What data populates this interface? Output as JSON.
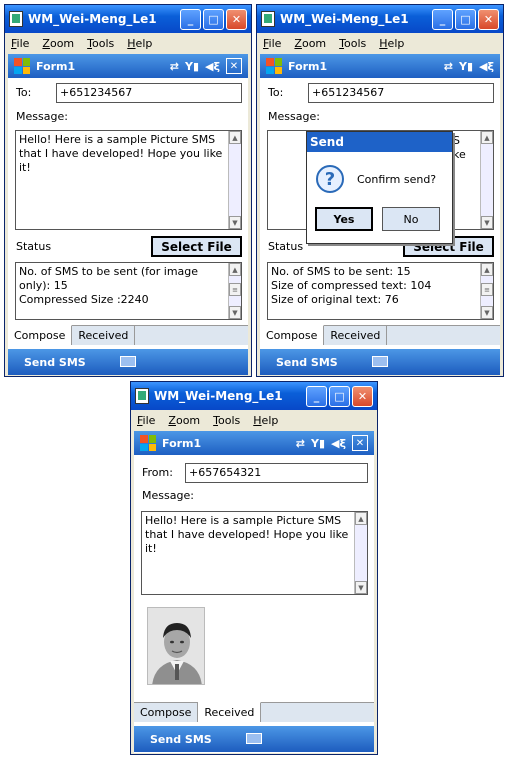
{
  "title": "WM_Wei-Meng_Le1",
  "menus": [
    "File",
    "Zoom",
    "Tools",
    "Help"
  ],
  "form_title": "Form1",
  "tabs": [
    "Compose",
    "Received"
  ],
  "softkey": "Send SMS",
  "colors": {
    "title_blue": "#0a5fd8",
    "panel_blue": "#1e5fc2"
  },
  "screen1": {
    "to_label": "To:",
    "to_value": "+651234567",
    "message_label": "Message:",
    "message_text": "Hello! Here is a sample Picture SMS that I have developed! Hope you like it!",
    "status_label": "Status",
    "select_file": "Select File",
    "status_lines": [
      "No. of SMS to be sent (for image only): 15",
      "Compressed Size :2240"
    ],
    "active_tab": "Compose"
  },
  "screen2": {
    "to_label": "To:",
    "to_value": "+651234567",
    "message_label": "Message:",
    "message_partial": [
      "S",
      "ke"
    ],
    "status_label": "Status",
    "select_file": "Select File",
    "status_lines": [
      "No. of SMS to be sent: 15",
      "Size of compressed text: 104",
      "Size of original text: 76"
    ],
    "dialog": {
      "title": "Send",
      "text": "Confirm send?",
      "yes": "Yes",
      "no": "No",
      "icon": "question-icon"
    },
    "active_tab": "Compose"
  },
  "screen3": {
    "from_label": "From:",
    "from_value": "+657654321",
    "message_label": "Message:",
    "message_text": "Hello! Here is a sample Picture SMS that I have developed! Hope you like it!",
    "photo": "portrait-photo",
    "active_tab": "Received"
  }
}
